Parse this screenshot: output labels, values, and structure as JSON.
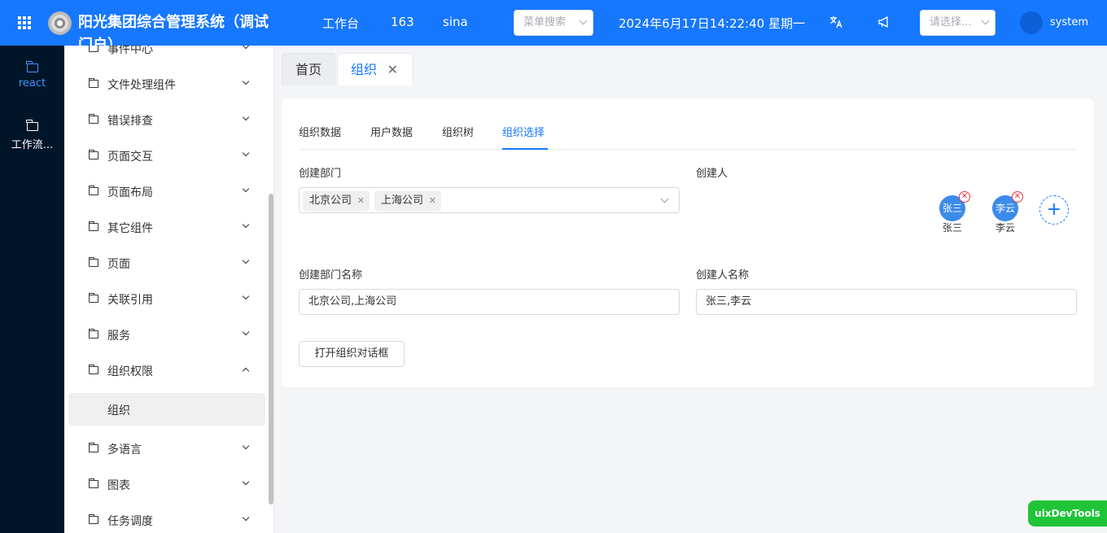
{
  "header": {
    "title": "阳光集团综合管理系统（调试门户）",
    "nav": [
      "工作台",
      "163",
      "sina"
    ],
    "menu_search_placeholder": "菜单搜索",
    "datetime": "2024年6月17日14:22:40 星期一",
    "lang_icon": "translate-icon",
    "notice_icon": "megaphone-icon",
    "select_placeholder": "请选择...",
    "user": "system"
  },
  "rail": {
    "items": [
      {
        "label": "react",
        "icon": "folder-icon",
        "active": true
      },
      {
        "label": "工作流...",
        "icon": "folder-icon",
        "active": false
      }
    ]
  },
  "menu": {
    "items": [
      {
        "label": "事件中心",
        "expanded": false
      },
      {
        "label": "文件处理组件",
        "expanded": false
      },
      {
        "label": "错误排查",
        "expanded": false
      },
      {
        "label": "页面交互",
        "expanded": false
      },
      {
        "label": "页面布局",
        "expanded": false
      },
      {
        "label": "其它组件",
        "expanded": false
      },
      {
        "label": "页面",
        "expanded": false
      },
      {
        "label": "关联引用",
        "expanded": false
      },
      {
        "label": "服务",
        "expanded": false
      },
      {
        "label": "组织权限",
        "expanded": true
      },
      {
        "label": "多语言",
        "expanded": false
      },
      {
        "label": "图表",
        "expanded": false
      },
      {
        "label": "任务调度",
        "expanded": false
      }
    ],
    "sub_item": "组织"
  },
  "tabs": [
    {
      "label": "首页",
      "active": false
    },
    {
      "label": "组织",
      "active": true
    }
  ],
  "subtabs": [
    {
      "label": "组织数据",
      "active": false
    },
    {
      "label": "用户数据",
      "active": false
    },
    {
      "label": "组织树",
      "active": false
    },
    {
      "label": "组织选择",
      "active": true
    }
  ],
  "form": {
    "dept_label": "创建部门",
    "dept_tags": [
      "北京公司",
      "上海公司"
    ],
    "creator_label": "创建人",
    "creators": [
      {
        "avatar": "张三",
        "name": "张三"
      },
      {
        "avatar": "李云",
        "name": "李云"
      }
    ],
    "dept_name_label": "创建部门名称",
    "dept_name_value": "北京公司,上海公司",
    "creator_name_label": "创建人名称",
    "creator_name_value": "张三,李云",
    "open_dialog_button": "打开组织对话框"
  },
  "devtools": "uixDevTools"
}
